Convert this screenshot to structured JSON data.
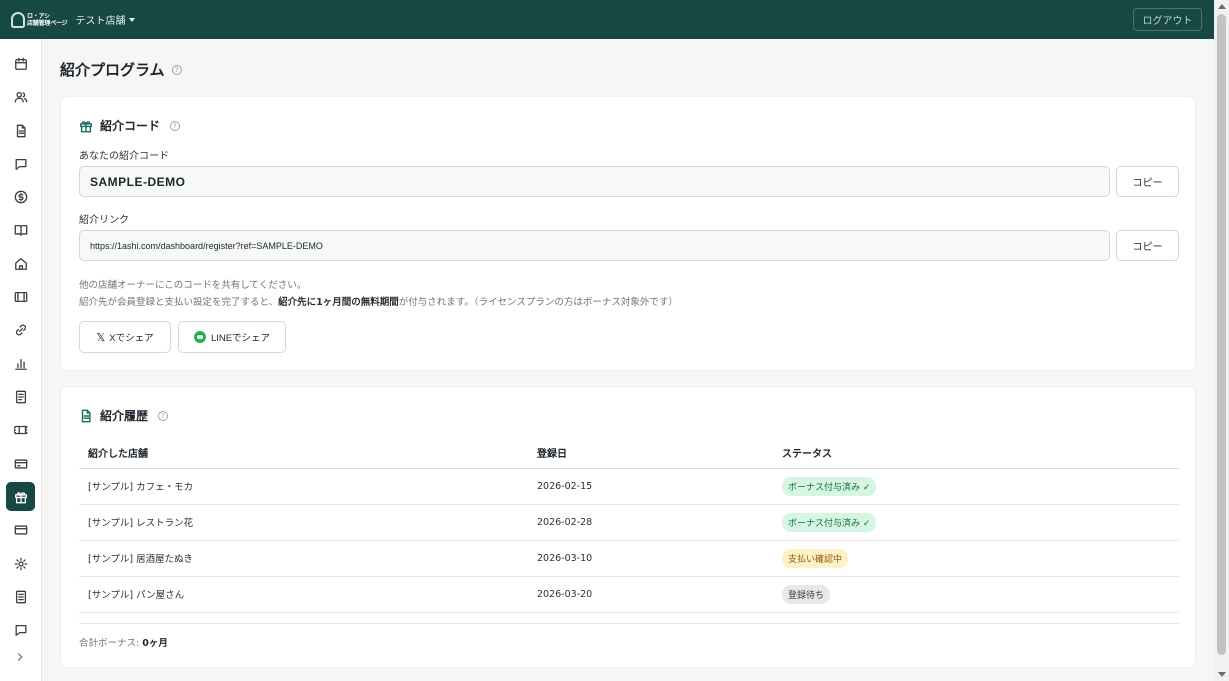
{
  "header": {
    "logo_line1": "ロ・アシ",
    "logo_line2": "店舗管理ページ",
    "store_name": "テスト店舗",
    "logout_label": "ログアウト"
  },
  "sidebar": {
    "icons": [
      "calendar-icon",
      "users-icon",
      "document-icon",
      "chat-icon",
      "dollar-icon",
      "book-icon",
      "home-icon",
      "film-icon",
      "link-icon",
      "bar-chart-icon",
      "notebook-icon",
      "ticket-icon",
      "credit-card-icon",
      "gift-icon",
      "card-icon",
      "gear-icon",
      "list-icon",
      "message-icon"
    ],
    "active_index": 13
  },
  "page": {
    "title": "紹介プログラム",
    "help_glyph": "?"
  },
  "referral_code": {
    "title": "紹介コード",
    "code_label": "あなたの紹介コード",
    "code_value": "SAMPLE-DEMO",
    "link_label": "紹介リンク",
    "link_value": "https://1ashi.com/dashboard/register?ref=SAMPLE-DEMO",
    "copy_label": "コピー",
    "note_line1": "他の店舗オーナーにこのコードを共有してください。",
    "note_line2_before": "紹介先が会員登録と支払い設定を完了すると、",
    "note_line2_bold": "紹介先に1ヶ月間の無料期間",
    "note_line2_after": "が付与されます。（ライセンスプランの方はボーナス対象外です）",
    "share_x_label": "Xでシェア",
    "share_line_label": "LINEでシェア"
  },
  "history": {
    "title": "紹介履歴",
    "columns": [
      "紹介した店舗",
      "登録日",
      "ステータス"
    ],
    "rows": [
      {
        "store": "[サンプル] カフェ・モカ",
        "date": "2026-02-15",
        "status": "ボーナス付与済み ✓",
        "tone": "green"
      },
      {
        "store": "[サンプル] レストラン花",
        "date": "2026-02-28",
        "status": "ボーナス付与済み ✓",
        "tone": "green"
      },
      {
        "store": "[サンプル] 居酒屋たぬき",
        "date": "2026-03-10",
        "status": "支払い確認中",
        "tone": "yellow"
      },
      {
        "store": "[サンプル] パン屋さん",
        "date": "2026-03-20",
        "status": "登録待ち",
        "tone": "gray"
      }
    ],
    "total_label": "合計ボーナス:",
    "total_value": "0ヶ月"
  },
  "colors": {
    "brand": "#174843",
    "accent": "#1b6a5f"
  }
}
